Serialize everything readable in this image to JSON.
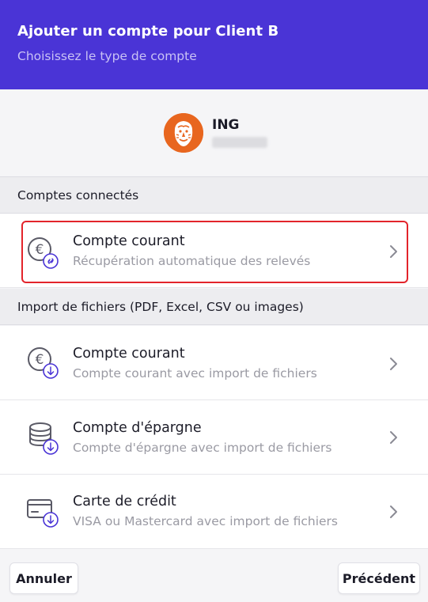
{
  "header": {
    "title": "Ajouter un compte pour Client B",
    "subtitle": "Choisissez le type de compte"
  },
  "bank": {
    "name": "ING",
    "logo": "ing-lion-logo"
  },
  "sections": [
    {
      "title": "Comptes connectés",
      "items": [
        {
          "title": "Compte courant",
          "subtitle": "Récupération automatique des relevés",
          "icon": "euro-link-icon"
        }
      ]
    },
    {
      "title": "Import de fichiers (PDF, Excel, CSV ou images)",
      "items": [
        {
          "title": "Compte courant",
          "subtitle": "Compte courant avec import de fichiers",
          "icon": "euro-download-icon"
        },
        {
          "title": "Compte d'épargne",
          "subtitle": "Compte d'épargne avec import de fichiers",
          "icon": "savings-download-icon"
        },
        {
          "title": "Carte de crédit",
          "subtitle": "VISA ou Mastercard avec import de fichiers",
          "icon": "credit-card-download-icon"
        }
      ]
    }
  ],
  "footer": {
    "cancel_label": "Annuler",
    "previous_label": "Précédent"
  },
  "colors": {
    "header_bg": "#4a34d6",
    "accent": "#4a34d6",
    "highlight": "#e3242b",
    "logo_orange": "#e8661f"
  }
}
